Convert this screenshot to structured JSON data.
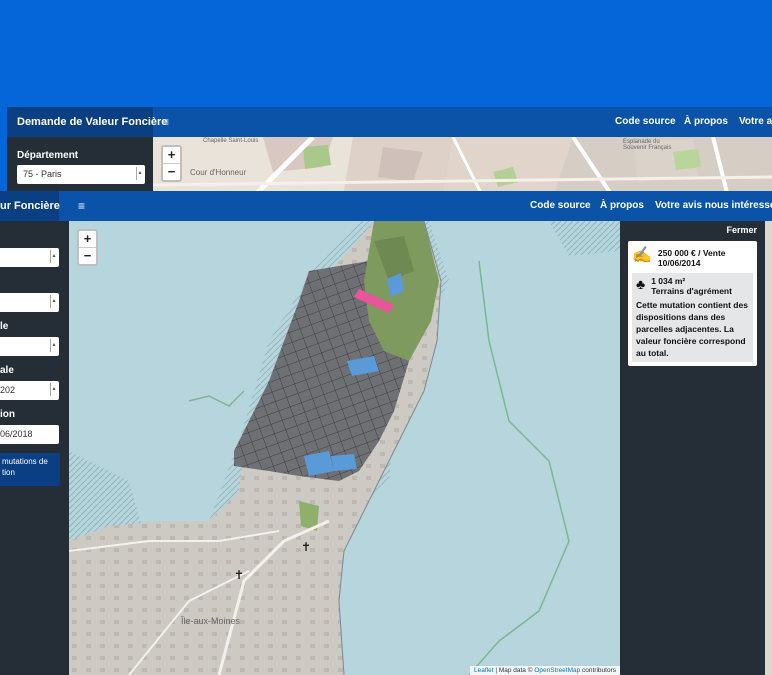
{
  "back_window": {
    "brand": "Demande de Valeur Foncière",
    "menu_icon": "hamburger-icon",
    "nav": [
      "Code source",
      "À propos",
      "Votre avis"
    ],
    "departement_label": "Département",
    "departement_value": "75 - Paris",
    "map_labels": [
      "Cour d'Honneur",
      "Chapelle Saint-Louis",
      "Esplanade du Souvenir Français"
    ],
    "zoom_in": "+",
    "zoom_out": "−"
  },
  "front_window": {
    "brand_fragment": "ur Foncière",
    "menu_icon": "hamburger-icon",
    "nav": [
      "Code source",
      "À propos",
      "Votre avis nous intéresse"
    ],
    "sidebar": {
      "labels": [
        "le",
        "ale",
        "ion"
      ],
      "selects": [
        "",
        "",
        "",
        "202"
      ],
      "date_value": "06/2018",
      "info_text": "mutations de\ntion"
    },
    "map": {
      "zoom_in": "+",
      "zoom_out": "−",
      "place_labels": [
        "Île-aux-Moines"
      ],
      "attribution": {
        "leaflet": "Leaflet",
        "sep": " | Map data © ",
        "osm": "OpenStreetMap",
        "tail": " contributors"
      }
    },
    "panel": {
      "close": "Fermer",
      "price": "250 000 € / Vente",
      "date": "10/06/2014",
      "area": "1 034 m²",
      "type": "Terrains d'agrément",
      "note": "Cette mutation contient des dispositions dans des parcelles adjacentes. La valeur foncière correspond au total."
    }
  },
  "colors": {
    "background": "#0466d8",
    "navbar": "#0b53a8",
    "brand": "#0a3f84",
    "sidebar": "#252e36",
    "sea": "#b7d5dc",
    "land": "#c9c5bf",
    "parcel": "#6d6e72",
    "green": "#7f9a5e",
    "selected": "#e8559b",
    "blue_parcel": "#5a9ad9"
  }
}
